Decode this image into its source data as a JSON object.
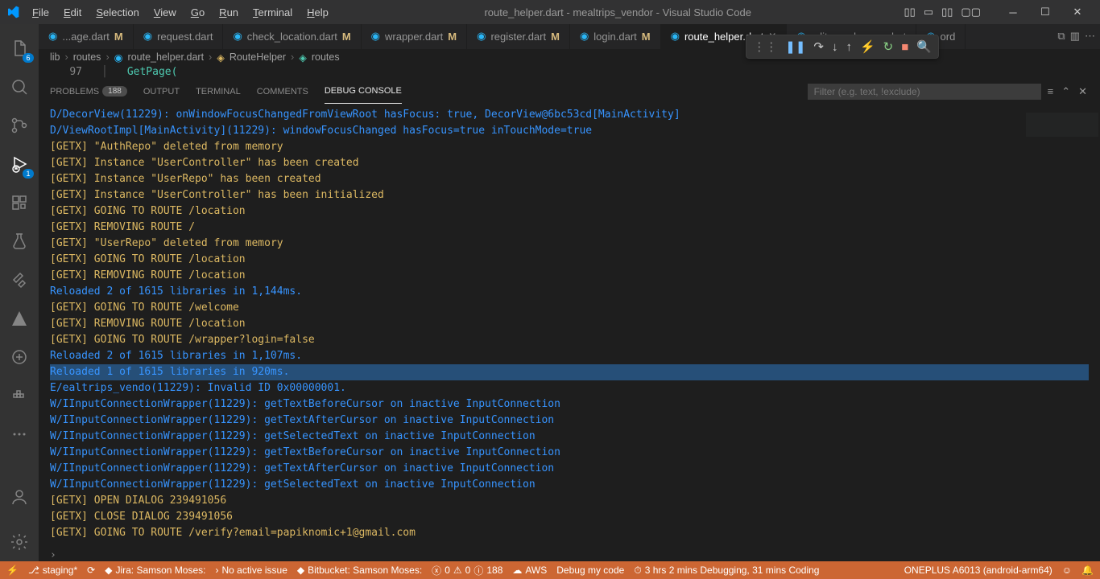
{
  "title": "route_helper.dart - mealtrips_vendor - Visual Studio Code",
  "menu": [
    "File",
    "Edit",
    "Selection",
    "View",
    "Go",
    "Run",
    "Terminal",
    "Help"
  ],
  "activity_badges": {
    "explorer": "6",
    "debug": "1"
  },
  "tabs": [
    {
      "label": "...age.dart",
      "mod": "M",
      "active": false,
      "icon": "dart"
    },
    {
      "label": "request.dart",
      "mod": "",
      "active": false,
      "icon": "dart"
    },
    {
      "label": "check_location.dart",
      "mod": "M",
      "active": false,
      "icon": "dart"
    },
    {
      "label": "wrapper.dart",
      "mod": "M",
      "active": false,
      "icon": "dart"
    },
    {
      "label": "register.dart",
      "mod": "M",
      "active": false,
      "icon": "dart"
    },
    {
      "label": "login.dart",
      "mod": "M",
      "active": false,
      "icon": "dart"
    },
    {
      "label": "route_helper.dart",
      "mod": "",
      "active": true,
      "icon": "dart",
      "close": true
    },
    {
      "label": "edit_meal_page.dart",
      "mod": "",
      "active": false,
      "icon": "dart"
    },
    {
      "label": "ord",
      "mod": "",
      "active": false,
      "icon": "dart"
    }
  ],
  "breadcrumb": {
    "parts": [
      "lib",
      "routes",
      "route_helper.dart",
      "RouteHelper",
      "routes"
    ]
  },
  "code": {
    "line_no": "97",
    "text": "GetPage("
  },
  "panel": {
    "tabs": [
      "PROBLEMS",
      "OUTPUT",
      "TERMINAL",
      "COMMENTS",
      "DEBUG CONSOLE"
    ],
    "active": "DEBUG CONSOLE",
    "problems_badge": "188",
    "filter_placeholder": "Filter (e.g. text, !exclude)"
  },
  "console_lines": [
    {
      "cls": "blue",
      "text": "D/DecorView(11229): onWindowFocusChangedFromViewRoot hasFocus: true, DecorView@6bc53cd[MainActivity]"
    },
    {
      "cls": "blue",
      "text": "D/ViewRootImpl[MainActivity](11229): windowFocusChanged hasFocus=true inTouchMode=true"
    },
    {
      "cls": "getx",
      "tag": "[GETX]",
      "msg": "\"AuthRepo\" deleted from memory"
    },
    {
      "cls": "getx",
      "tag": "[GETX]",
      "msg": "Instance \"UserController\" has been created"
    },
    {
      "cls": "getx",
      "tag": "[GETX]",
      "msg": "Instance \"UserRepo\" has been created"
    },
    {
      "cls": "getx",
      "tag": "[GETX]",
      "msg": "Instance \"UserController\" has been initialized"
    },
    {
      "cls": "getx",
      "tag": "[GETX]",
      "msg": "GOING TO ROUTE /location"
    },
    {
      "cls": "getx",
      "tag": "[GETX]",
      "msg": "REMOVING ROUTE /"
    },
    {
      "cls": "getx",
      "tag": "[GETX]",
      "msg": "\"UserRepo\" deleted from memory"
    },
    {
      "cls": "getx",
      "tag": "[GETX]",
      "msg": "GOING TO ROUTE /location"
    },
    {
      "cls": "getx",
      "tag": "[GETX]",
      "msg": "REMOVING ROUTE /location"
    },
    {
      "cls": "blue",
      "text": "Reloaded 2 of 1615 libraries in 1,144ms."
    },
    {
      "cls": "getx",
      "tag": "[GETX]",
      "msg": "GOING TO ROUTE /welcome"
    },
    {
      "cls": "getx",
      "tag": "[GETX]",
      "msg": "REMOVING ROUTE /location"
    },
    {
      "cls": "getx",
      "tag": "[GETX]",
      "msg": "GOING TO ROUTE /wrapper?login=false"
    },
    {
      "cls": "blue",
      "text": "Reloaded 2 of 1615 libraries in 1,107ms."
    },
    {
      "cls": "blue-hl",
      "text": "Reloaded 1 of 1615 libraries in 920ms."
    },
    {
      "cls": "blue",
      "text": "E/ealtrips_vendo(11229): Invalid ID 0x00000001."
    },
    {
      "cls": "blue",
      "text": "W/IInputConnectionWrapper(11229): getTextBeforeCursor on inactive InputConnection"
    },
    {
      "cls": "blue",
      "text": "W/IInputConnectionWrapper(11229): getTextAfterCursor on inactive InputConnection"
    },
    {
      "cls": "blue",
      "text": "W/IInputConnectionWrapper(11229): getSelectedText on inactive InputConnection"
    },
    {
      "cls": "blue",
      "text": "W/IInputConnectionWrapper(11229): getTextBeforeCursor on inactive InputConnection"
    },
    {
      "cls": "blue",
      "text": "W/IInputConnectionWrapper(11229): getTextAfterCursor on inactive InputConnection"
    },
    {
      "cls": "blue",
      "text": "W/IInputConnectionWrapper(11229): getSelectedText on inactive InputConnection"
    },
    {
      "cls": "getx",
      "tag": "[GETX]",
      "msg": "OPEN DIALOG 239491056"
    },
    {
      "cls": "getx",
      "tag": "[GETX]",
      "msg": "CLOSE DIALOG 239491056"
    },
    {
      "cls": "getx",
      "tag": "[GETX]",
      "msg": "GOING TO ROUTE /verify?email=papiknomic+1@gmail.com"
    }
  ],
  "status": {
    "branch": "staging*",
    "jira_label": "Jira: Samson Moses:",
    "no_issue": "No active issue",
    "bitbucket": "Bitbucket: Samson Moses:",
    "errors": "0",
    "warnings": "0",
    "info": "188",
    "aws": "AWS",
    "debug": "Debug my code",
    "time": "3 hrs 2 mins Debugging, 31 mins Coding",
    "device": "ONEPLUS A6013 (android-arm64)"
  }
}
